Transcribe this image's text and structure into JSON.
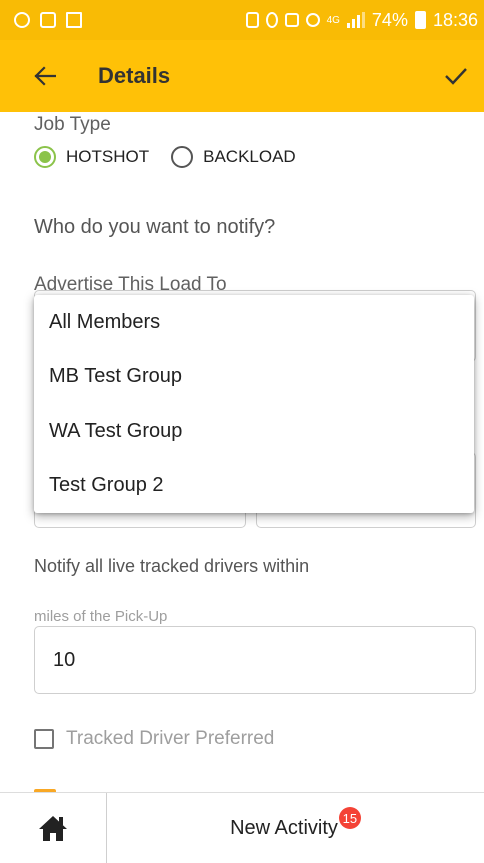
{
  "status_bar": {
    "battery": "74%",
    "time": "18:36",
    "network": "4G"
  },
  "app_bar": {
    "title": "Details",
    "icons": {
      "back": "arrow-left",
      "confirm": "checkmark"
    }
  },
  "form": {
    "job_type_label": "Job Type",
    "job_type_options": [
      {
        "label": "HOTSHOT",
        "selected": true
      },
      {
        "label": "BACKLOAD",
        "selected": false
      }
    ],
    "notify_heading": "Who do you want to notify?",
    "advertise_label": "Advertise This Load To",
    "advertise_options": [
      "All Members",
      "MB Test Group",
      "WA Test Group",
      "Test Group 2"
    ],
    "live_tracked_label": "Notify all live tracked drivers within",
    "miles_label": "miles of the Pick-Up",
    "miles_value": "10",
    "tracked_driver_label": "Tracked Driver Preferred",
    "tracked_driver_checked": false
  },
  "bottom_nav": {
    "home_icon": "home-icon",
    "activity_label": "New Activity",
    "activity_badge": "15"
  },
  "colors": {
    "status_bar": "#F9BB05",
    "app_bar": "#FFC107",
    "radio_selected": "#8BC34A",
    "badge": "#F44336"
  }
}
